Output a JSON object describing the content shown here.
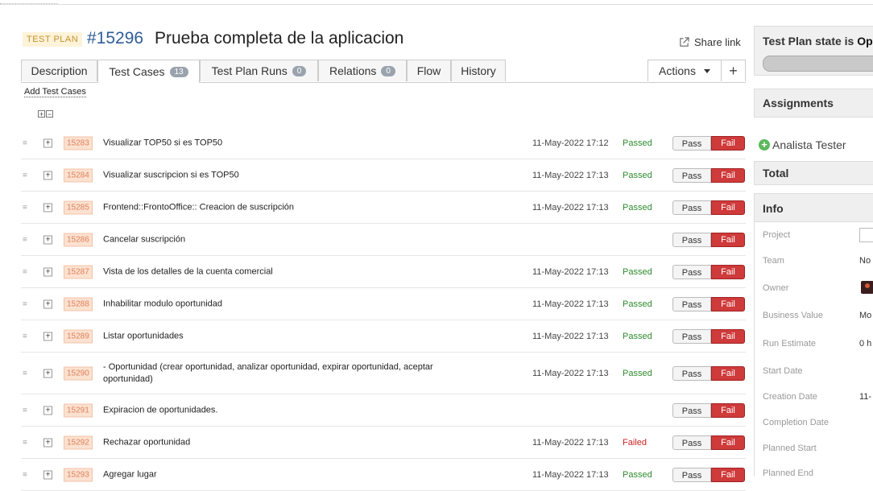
{
  "header": {
    "badge": "TEST PLAN",
    "entity_id": "#15296",
    "title": "Prueba completa de la aplicacion",
    "share_link": "Share link"
  },
  "tabs": [
    {
      "label": "Description",
      "count": null
    },
    {
      "label": "Test Cases",
      "count": "13"
    },
    {
      "label": "Test Plan Runs",
      "count": "0"
    },
    {
      "label": "Relations",
      "count": "0"
    },
    {
      "label": "Flow",
      "count": null
    },
    {
      "label": "History",
      "count": null
    }
  ],
  "actions_label": "Actions",
  "add_test_cases": "Add Test Cases",
  "buttons": {
    "pass": "Pass",
    "fail": "Fail"
  },
  "test_cases": [
    {
      "id": "15283",
      "name": "Visualizar TOP50 si es TOP50",
      "date": "11-May-2022 17:12",
      "status": "Passed"
    },
    {
      "id": "15284",
      "name": "Visualizar suscripcion si es TOP50",
      "date": "11-May-2022 17:13",
      "status": "Passed"
    },
    {
      "id": "15285",
      "name": "Frontend::FrontoOffice:: Creacion de suscripción",
      "date": "11-May-2022 17:13",
      "status": "Passed"
    },
    {
      "id": "15286",
      "name": "Cancelar suscripción",
      "date": "",
      "status": ""
    },
    {
      "id": "15287",
      "name": "Vista de los detalles de la cuenta comercial",
      "date": "11-May-2022 17:13",
      "status": "Passed"
    },
    {
      "id": "15288",
      "name": "Inhabilitar modulo oportunidad",
      "date": "11-May-2022 17:13",
      "status": "Passed"
    },
    {
      "id": "15289",
      "name": "Listar oportunidades",
      "date": "11-May-2022 17:13",
      "status": "Passed"
    },
    {
      "id": "15290",
      "name": "- Oportunidad (crear oportunidad, analizar oportunidad, expirar oportunidad, aceptar oportunidad)",
      "date": "11-May-2022 17:13",
      "status": "Passed"
    },
    {
      "id": "15291",
      "name": "Expiracion de oportunidades.",
      "date": "",
      "status": ""
    },
    {
      "id": "15292",
      "name": "Rechazar oportunidad",
      "date": "11-May-2022 17:13",
      "status": "Failed"
    },
    {
      "id": "15293",
      "name": "Agregar lugar",
      "date": "11-May-2022 17:13",
      "status": "Passed"
    }
  ],
  "sidebar": {
    "state_label": "Test Plan state is",
    "state_value": "Op",
    "assignments": "Assignments",
    "assignee": "Analista Tester",
    "total": "Total",
    "info": "Info",
    "fields": [
      {
        "label": "Project",
        "value": ""
      },
      {
        "label": "Team",
        "value": "No"
      },
      {
        "label": "Owner",
        "value": ""
      },
      {
        "label": "Business Value",
        "value": "Mo"
      },
      {
        "label": "Run Estimate",
        "value": "0 h"
      },
      {
        "label": "Start Date",
        "value": ""
      },
      {
        "label": "Creation Date",
        "value": "11-"
      },
      {
        "label": "Completion Date",
        "value": ""
      },
      {
        "label": "Planned Start",
        "value": ""
      },
      {
        "label": "Planned End",
        "value": ""
      }
    ]
  },
  "colors": {
    "passed": "#2e8b2e",
    "failed": "#cc2222",
    "fail_button": "#cf3a3a",
    "id_badge": "#fbe1d0",
    "title_id": "#2f5d97"
  }
}
